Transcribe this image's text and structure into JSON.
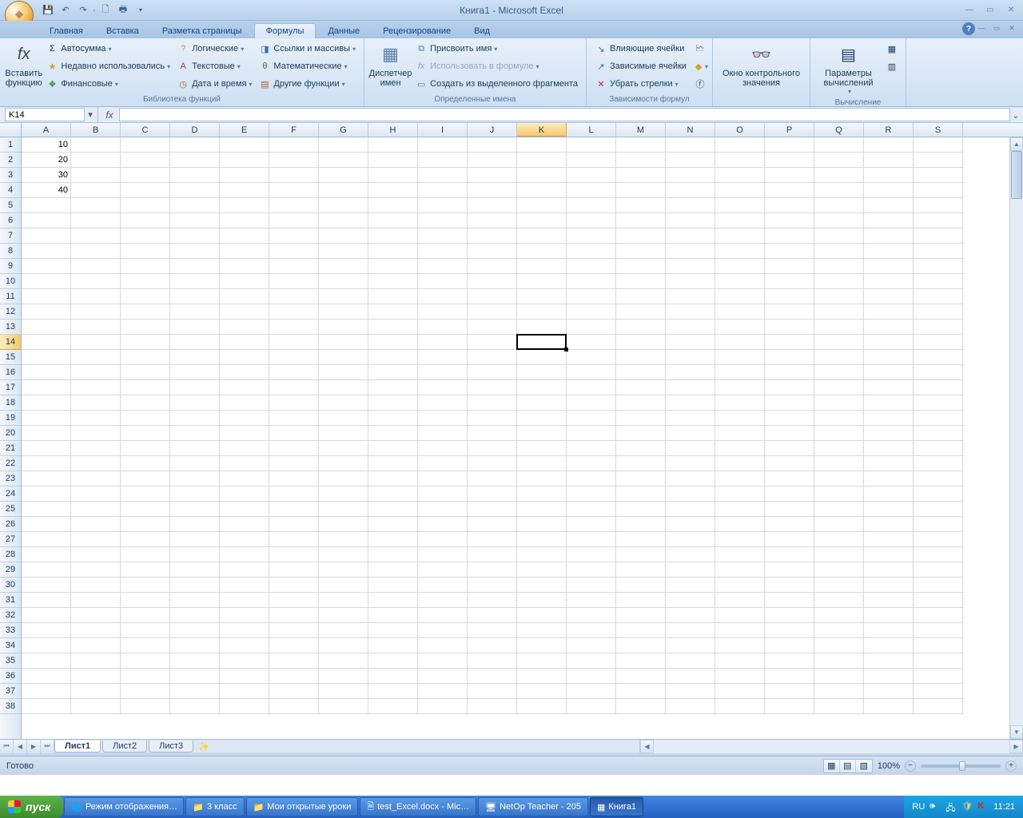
{
  "titlebar": {
    "title": "Книга1 - Microsoft Excel"
  },
  "tabs": {
    "items": [
      "Главная",
      "Вставка",
      "Разметка страницы",
      "Формулы",
      "Данные",
      "Рецензирование",
      "Вид"
    ],
    "active_index": 3
  },
  "ribbon": {
    "insert_function": "Вставить функцию",
    "group1": {
      "autosum": "Автосумма",
      "recent": "Недавно использовались",
      "financial": "Финансовые",
      "logical": "Логические",
      "text": "Текстовые",
      "datetime": "Дата и время",
      "lookup": "Ссылки и массивы",
      "math": "Математические",
      "more": "Другие функции",
      "label": "Библиотека функций"
    },
    "group2": {
      "name_manager": "Диспетчер имен",
      "define": "Присвоить имя",
      "use_in_formula": "Использовать в формуле",
      "create_from_sel": "Создать из выделенного фрагмента",
      "label": "Определенные имена"
    },
    "group3": {
      "trace_prec": "Влияющие ячейки",
      "trace_dep": "Зависимые ячейки",
      "remove_arrows": "Убрать стрелки",
      "label": "Зависимости формул"
    },
    "group4": {
      "watch": "Окно контрольного значения",
      "calc_options": "Параметры вычислений",
      "label": "Вычисление"
    }
  },
  "formula_bar": {
    "name_box": "K14",
    "formula": ""
  },
  "grid": {
    "columns": [
      "A",
      "B",
      "C",
      "D",
      "E",
      "F",
      "G",
      "H",
      "I",
      "J",
      "K",
      "L",
      "M",
      "N",
      "O",
      "P",
      "Q",
      "R",
      "S"
    ],
    "row_count": 38,
    "data": {
      "A1": "10",
      "A2": "20",
      "A3": "30",
      "A4": "40"
    },
    "active": {
      "col": "K",
      "col_index": 10,
      "row": 14
    }
  },
  "sheets": {
    "tabs": [
      "Лист1",
      "Лист2",
      "Лист3"
    ],
    "active_index": 0
  },
  "status": {
    "ready": "Готово",
    "zoom": "100%"
  },
  "taskbar": {
    "start": "пуск",
    "items": [
      "Режим отображения…",
      "3 класс",
      "Мои открытые уроки",
      "test_Excel.docx - Mic…",
      "NetOp Teacher - 205",
      "Книга1"
    ],
    "active_index": 5,
    "lang": "RU",
    "clock": "11:21"
  }
}
